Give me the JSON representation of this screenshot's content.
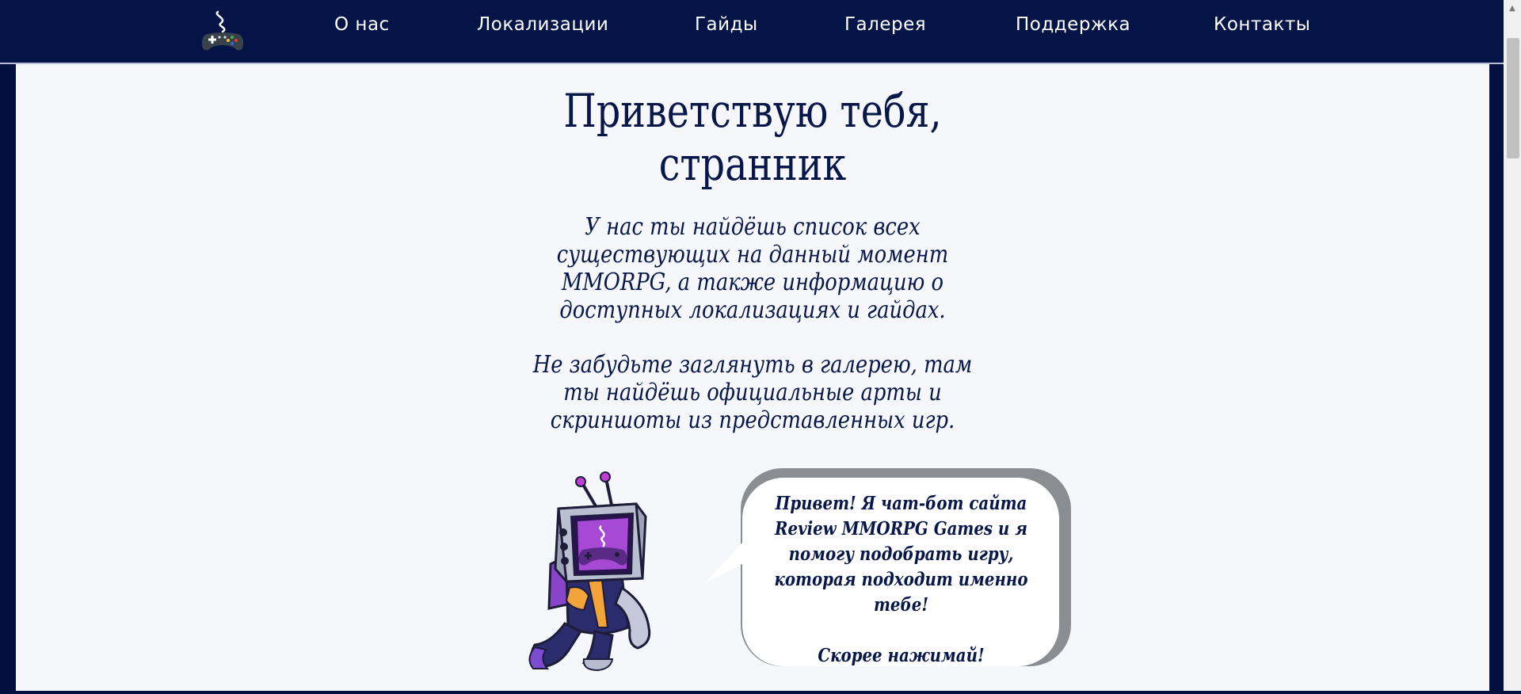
{
  "nav": {
    "logo_icon": "gamepad-logo-icon",
    "items": [
      {
        "label": "О нас"
      },
      {
        "label": "Локализации"
      },
      {
        "label": "Гайды"
      },
      {
        "label": "Галерея"
      },
      {
        "label": "Поддержка"
      },
      {
        "label": "Контакты"
      }
    ]
  },
  "hero": {
    "title_line1": "Приветствую тебя,",
    "title_line2": "странник",
    "paragraph1": "У нас ты найдёшь список всех существующих на данный момент MMORPG, а также информацию о доступных локализациях и гайдах.",
    "paragraph2": "Не забудьте заглянуть в галерею, там ты найдёшь официальные арты и скриншоты из представленных игр."
  },
  "chatbot": {
    "mascot_icon": "tv-robot-mascot-icon",
    "message": "Привет! Я чат-бот сайта Review MMORPG Games и я помогу подобрать игру, которая подходит именно тебе!",
    "cta": "Скорее нажимай!"
  },
  "colors": {
    "nav_bg": "#051447",
    "page_bg": "#03103f",
    "panel_bg": "#f5f7fa",
    "text": "#081749"
  }
}
